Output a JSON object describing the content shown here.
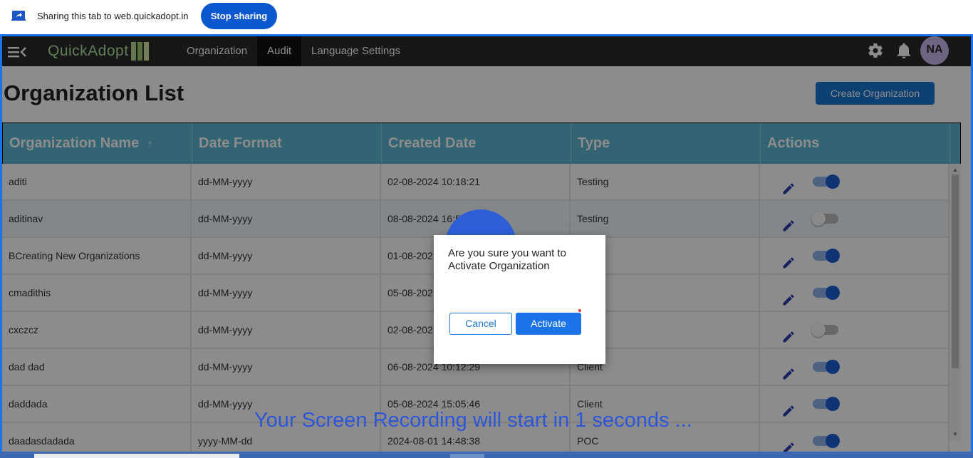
{
  "share_bar": {
    "message": "Sharing this tab to web.quickadopt.in",
    "stop_label": "Stop sharing"
  },
  "nav": {
    "logo_text": "QuickAdopt",
    "items": [
      {
        "label": "Organization"
      },
      {
        "label": "Audit",
        "active": true
      },
      {
        "label": "Language Settings"
      }
    ],
    "avatar_initials": "NA"
  },
  "page": {
    "title": "Organization List",
    "create_button": "Create Organization"
  },
  "table": {
    "headers": [
      "Organization Name",
      "Date Format",
      "Created Date",
      "Type",
      "Actions"
    ],
    "sort_indicator": "↑",
    "rows": [
      {
        "name": "aditi",
        "date_format": "dd-MM-yyyy",
        "created": "02-08-2024 10:18:21",
        "type": "Testing",
        "active": true
      },
      {
        "name": "aditinav",
        "date_format": "dd-MM-yyyy",
        "created": "08-08-2024 16:5",
        "type": "Testing",
        "active": false
      },
      {
        "name": "BCreating New Organizations",
        "date_format": "dd-MM-yyyy",
        "created": "01-08-202",
        "type": "",
        "active": true
      },
      {
        "name": "cmadithis",
        "date_format": "dd-MM-yyyy",
        "created": "05-08-202",
        "type": "",
        "active": true
      },
      {
        "name": "cxczcz",
        "date_format": "dd-MM-yyyy",
        "created": "02-08-202",
        "type": "",
        "active": false
      },
      {
        "name": "dad dad",
        "date_format": "dd-MM-yyyy",
        "created": "06-08-2024 10:12:29",
        "type": "Client",
        "active": true
      },
      {
        "name": "daddada",
        "date_format": "dd-MM-yyyy",
        "created": "05-08-2024 15:05:46",
        "type": "Client",
        "active": true
      },
      {
        "name": "daadasdadada",
        "date_format": "yyyy-MM-dd",
        "created": "2024-08-01 14:48:38",
        "type": "POC",
        "active": true
      }
    ]
  },
  "dialog": {
    "message": "Are you sure you want to Activate Organization",
    "cancel_label": "Cancel",
    "activate_label": "Activate"
  },
  "recording_notice": "Your Screen Recording will start in 1 seconds ...",
  "colors": {
    "accent": "#1976d2",
    "header_bg": "#5cb6d1",
    "nav_bg": "#2b2b2b",
    "toggle_on": "#1a5fd6"
  }
}
